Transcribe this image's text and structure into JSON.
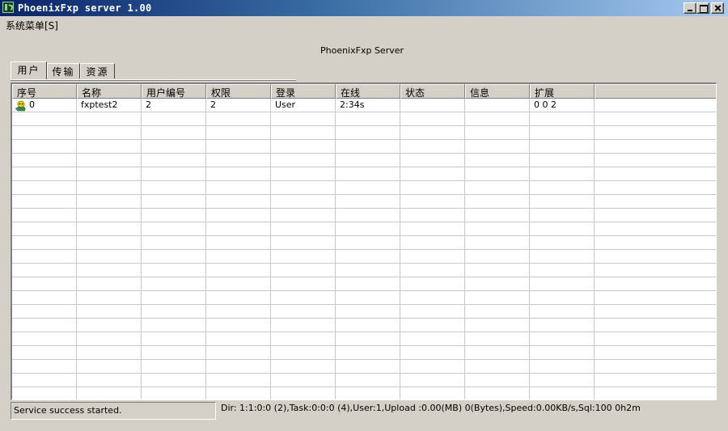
{
  "window": {
    "title": "PhoenixFxp server 1.00",
    "minimize_icon": "minimize-icon",
    "maximize_icon": "maximize-icon",
    "close_icon": "close-icon"
  },
  "menu": {
    "items": [
      {
        "label": "系统菜单[S]"
      }
    ]
  },
  "server_label": "PhoenixFxp Server",
  "tabs": [
    {
      "label": "用户",
      "active": true
    },
    {
      "label": "传输",
      "active": false
    },
    {
      "label": "资源",
      "active": false
    }
  ],
  "table": {
    "columns": [
      "序号",
      "名称",
      "用户编号",
      "权限",
      "登录",
      "在线",
      "状态",
      "信息",
      "扩展"
    ],
    "rows": [
      {
        "icon": "user-online-icon",
        "cells": [
          "0",
          "fxptest2",
          "2",
          "2",
          "User",
          "2:34s",
          "",
          "",
          "0 0 2"
        ]
      }
    ]
  },
  "status": {
    "message": "Service success started.",
    "stats": "Dir: 1:1:0:0 (2),Task:0:0:0 (4),User:1,Upload :0.00(MB) 0(Bytes),Speed:0.00KB/s,Sql:100 0h2m"
  },
  "colors": {
    "titlebar_start": "#0a246a",
    "titlebar_end": "#a6caf0",
    "face": "#d4d0c8"
  }
}
